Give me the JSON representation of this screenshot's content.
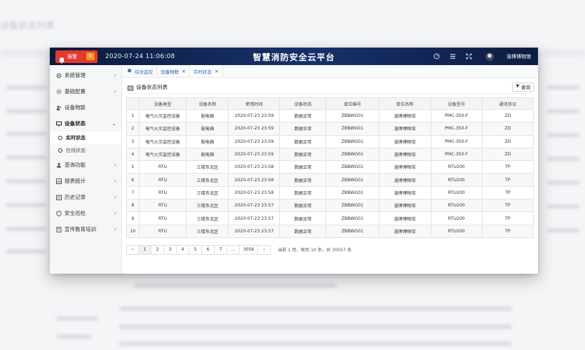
{
  "header": {
    "alarm_label": "报警",
    "alarm_count": "0",
    "datetime": "2020-07-24 11:06:08",
    "app_title": "智慧消防安全云平台",
    "user_name": "淄博博物馆"
  },
  "sidebar": {
    "items": [
      {
        "label": "系统管理",
        "icon": "gear-icon",
        "chevron": "‹"
      },
      {
        "label": "基础配置",
        "icon": "settings-icon",
        "chevron": "‹"
      },
      {
        "label": "设备物联",
        "icon": "users-icon",
        "chevron": ""
      },
      {
        "label": "设备状态",
        "icon": "monitor-icon",
        "chevron": "⌄"
      },
      {
        "label": "查询功能",
        "icon": "user-icon",
        "chevron": "‹"
      },
      {
        "label": "报表统计",
        "icon": "chart-icon",
        "chevron": "‹"
      },
      {
        "label": "历史记录",
        "icon": "history-icon",
        "chevron": "‹"
      },
      {
        "label": "安全巡检",
        "icon": "shield-icon",
        "chevron": "‹"
      },
      {
        "label": "宣传教育培训",
        "icon": "book-icon",
        "chevron": "‹"
      }
    ],
    "subitems": [
      {
        "label": "实时状态"
      },
      {
        "label": "在线状态"
      }
    ]
  },
  "tabs": [
    {
      "label": "综合监控"
    },
    {
      "label": "设备物联"
    },
    {
      "label": "实时状态"
    }
  ],
  "panel": {
    "title": "设备状态列表",
    "query_label": "查询"
  },
  "table": {
    "columns": [
      "",
      "设备类型",
      "设备名称",
      "使用时间",
      "设备状态",
      "单位编号",
      "单位名称",
      "设备型号",
      "通讯协议"
    ],
    "rows": [
      [
        "1",
        "电气火灾监控设备",
        "配电箱",
        "2020-07-23 23:59",
        "数据正常",
        "ZBBWG01",
        "淄博博物馆",
        "PMC-350-F",
        "ZD"
      ],
      [
        "2",
        "电气火灾监控设备",
        "配电箱",
        "2020-07-23 23:59",
        "数据正常",
        "ZBBWG01",
        "淄博博物馆",
        "PMC-350-F",
        "ZD"
      ],
      [
        "3",
        "电气火灾监控设备",
        "配电箱",
        "2020-07-23 23:59",
        "数据正常",
        "ZBBWG01",
        "淄博博物馆",
        "PMC-350-F",
        "ZD"
      ],
      [
        "4",
        "电气火灾监控设备",
        "配电箱",
        "2020-07-23 23:59",
        "数据正常",
        "ZBBWG01",
        "淄博博物馆",
        "PMC-350-F",
        "ZD"
      ],
      [
        "5",
        "RTU",
        "三楼东北区",
        "2020-07-23 23:58",
        "数据正常",
        "ZBBWG01",
        "淄博博物馆",
        "RTU200",
        "TP"
      ],
      [
        "6",
        "RTU",
        "三楼东北区",
        "2020-07-23 23:58",
        "数据正常",
        "ZBBWG01",
        "淄博博物馆",
        "RTU200",
        "TP"
      ],
      [
        "7",
        "RTU",
        "三楼东北区",
        "2020-07-23 23:58",
        "数据正常",
        "ZBBWG01",
        "淄博博物馆",
        "RTU200",
        "TP"
      ],
      [
        "8",
        "RTU",
        "三楼东北区",
        "2020-07-23 23:57",
        "数据正常",
        "ZBBWG01",
        "淄博博物馆",
        "RTU200",
        "TP"
      ],
      [
        "9",
        "RTU",
        "三楼东北区",
        "2020-07-23 23:57",
        "数据正常",
        "ZBBWG01",
        "淄博博物馆",
        "RTU200",
        "TP"
      ],
      [
        "10",
        "RTU",
        "三楼东北区",
        "2020-07-23 23:57",
        "数据正常",
        "ZBBWG01",
        "淄博博物馆",
        "RTU200",
        "TP"
      ]
    ]
  },
  "pager": {
    "prev": "‹",
    "pages": [
      "1",
      "2",
      "3",
      "4",
      "5",
      "6",
      "7",
      "...",
      "3056"
    ],
    "next": "›",
    "info": "当前 1 页，每页 10 条，共 30557 条"
  },
  "ghost": {
    "sidebar_title": "设备状态列表"
  }
}
